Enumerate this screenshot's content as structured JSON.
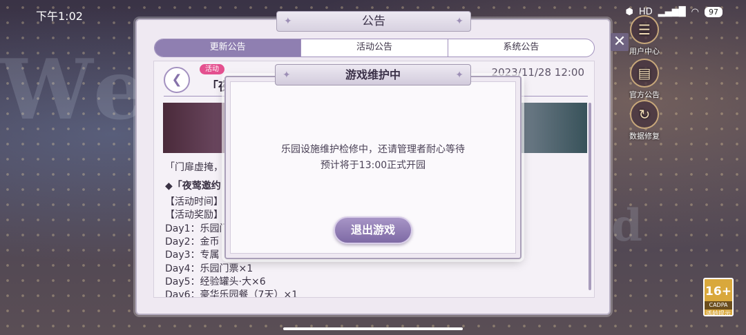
{
  "status_bar": {
    "time": "下午1:02",
    "signal": "HD",
    "battery": "97"
  },
  "side_menu": [
    {
      "label": "用户中心",
      "icon": "user-center-icon"
    },
    {
      "label": "官方公告",
      "icon": "announcement-icon"
    },
    {
      "label": "数据修复",
      "icon": "data-repair-icon"
    }
  ],
  "panel": {
    "title": "公告",
    "tabs": [
      "更新公告",
      "活动公告",
      "系统公告"
    ],
    "active_tab": 0,
    "announcement": {
      "tag": "活动",
      "title": "「夜",
      "date": "2023/11/28 12:00",
      "intro": "「门扉虚掩，",
      "heading": "◆「夜莺邀约",
      "time_label": "【活动时间】",
      "reward_label": "【活动奖励】",
      "rewards": [
        "Day1：乐园门",
        "Day2：金币",
        "Day3：专属",
        "Day4：乐园门票×1",
        "Day5：经验罐头·大×6",
        "Day6：豪华乐园餐（7天）×1"
      ]
    }
  },
  "modal": {
    "title": "游戏维护中",
    "message_line1": "乐园设施维护检修中，还请管理者耐心等待",
    "message_line2": "预计将于13:00正式开园",
    "exit_button": "退出游戏"
  },
  "age_rating": {
    "number": "16+",
    "caption": "CADPA",
    "label": "适龄提示"
  },
  "colors": {
    "accent": "#8f7fb1",
    "tag": "#e4508f",
    "panel_bg": "#efe9f2"
  }
}
